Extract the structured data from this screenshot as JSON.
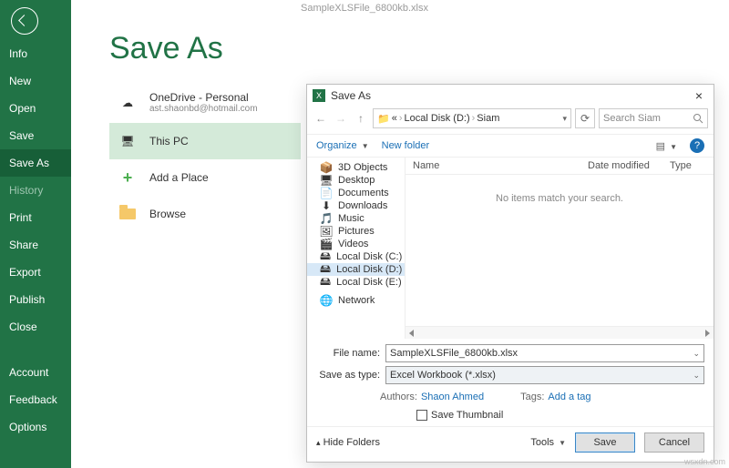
{
  "topbar": {
    "doc": "SampleXLSFile_6800kb.xlsx"
  },
  "page": {
    "title": "Save As"
  },
  "sidebar": {
    "items": [
      "Info",
      "New",
      "Open",
      "Save",
      "Save As",
      "History",
      "Print",
      "Share",
      "Export",
      "Publish",
      "Close"
    ],
    "selected": 4,
    "muted": [
      5
    ],
    "footer": [
      "Account",
      "Feedback",
      "Options"
    ]
  },
  "places": [
    {
      "icon": "onedrive",
      "title": "OneDrive - Personal",
      "sub": "ast.shaonbd@hotmail.com"
    },
    {
      "icon": "thispc",
      "title": "This PC",
      "selected": true
    },
    {
      "icon": "plus",
      "title": "Add a Place"
    },
    {
      "icon": "folder",
      "title": "Browse"
    }
  ],
  "dialog": {
    "title": "Save As",
    "crumb": [
      "«",
      "Local Disk (D:)",
      "Siam"
    ],
    "search_placeholder": "Search Siam",
    "toolbar": {
      "organize": "Organize",
      "newfolder": "New folder"
    },
    "tree": [
      {
        "label": "3D Objects",
        "icon": "📦"
      },
      {
        "label": "Desktop",
        "icon": "🖥"
      },
      {
        "label": "Documents",
        "icon": "📄"
      },
      {
        "label": "Downloads",
        "icon": "⬇"
      },
      {
        "label": "Music",
        "icon": "🎵"
      },
      {
        "label": "Pictures",
        "icon": "🖼"
      },
      {
        "label": "Videos",
        "icon": "🎬"
      },
      {
        "label": "Local Disk (C:)",
        "icon": "🖴"
      },
      {
        "label": "Local Disk (D:)",
        "icon": "🖴",
        "selected": true
      },
      {
        "label": "Local Disk (E:)",
        "icon": "🖴"
      },
      {
        "label": "Network",
        "icon": "🌐",
        "gap": true
      }
    ],
    "columns": {
      "name": "Name",
      "date": "Date modified",
      "type": "Type"
    },
    "empty": "No items match your search.",
    "filename_label": "File name:",
    "filename": "SampleXLSFile_6800kb.xlsx",
    "saveas_label": "Save as type:",
    "saveas": "Excel Workbook (*.xlsx)",
    "authors_label": "Authors:",
    "authors": "Shaon Ahmed",
    "tags_label": "Tags:",
    "tags": "Add a tag",
    "thumb": "Save Thumbnail",
    "hide": "Hide Folders",
    "tools": "Tools",
    "save": "Save",
    "cancel": "Cancel"
  },
  "watermark": "wsxdn.com"
}
